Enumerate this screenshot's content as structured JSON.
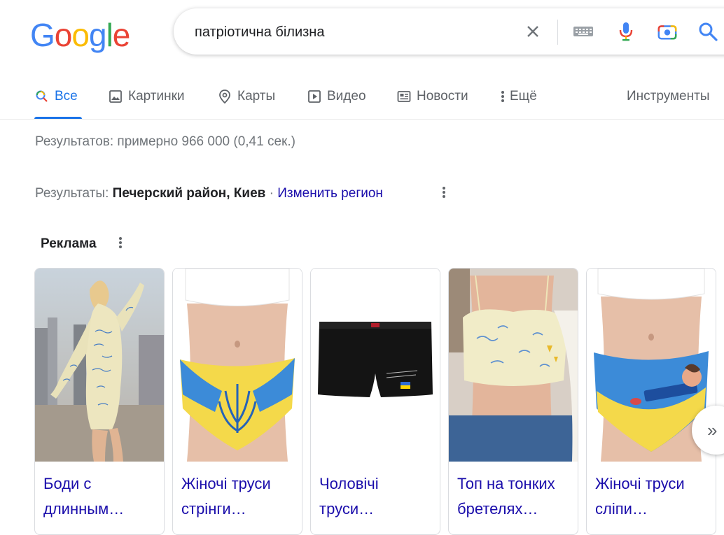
{
  "logo": {
    "letters": [
      "G",
      "o",
      "o",
      "g",
      "l",
      "e"
    ],
    "colors": [
      "#4285f4",
      "#ea4335",
      "#fbbc05",
      "#4285f4",
      "#34a853",
      "#ea4335"
    ]
  },
  "search": {
    "query": "патріотична білизна",
    "icons": [
      "close-icon",
      "keyboard-icon",
      "mic-icon",
      "camera-icon",
      "search-icon"
    ]
  },
  "tabs": [
    {
      "label": "Все",
      "icon": "search-icon",
      "active": true
    },
    {
      "label": "Картинки",
      "icon": "image-icon"
    },
    {
      "label": "Карты",
      "icon": "map-pin-icon"
    },
    {
      "label": "Видео",
      "icon": "play-icon"
    },
    {
      "label": "Новости",
      "icon": "news-icon"
    },
    {
      "label": "Ещё",
      "icon": "more-vert-icon"
    }
  ],
  "tools_label": "Инструменты",
  "stats": "Результатов: примерно 966 000 (0,41 сек.)",
  "region": {
    "prefix": "Результаты: ",
    "location": "Печерский район, Киев",
    "separator": " · ",
    "change_link": "Изменить регион"
  },
  "ads": {
    "label": "Реклама",
    "products": [
      {
        "title_line1": "Боди с",
        "title_line2": "длинным…"
      },
      {
        "title_line1": "Жіночі труси",
        "title_line2": "стрінги…"
      },
      {
        "title_line1": "Чоловічі",
        "title_line2": "труси…"
      },
      {
        "title_line1": "Топ на тонких",
        "title_line2": "бретелях…"
      },
      {
        "title_line1": "Жіночі труси",
        "title_line2": "сліпи…"
      }
    ]
  },
  "next_label": "»"
}
